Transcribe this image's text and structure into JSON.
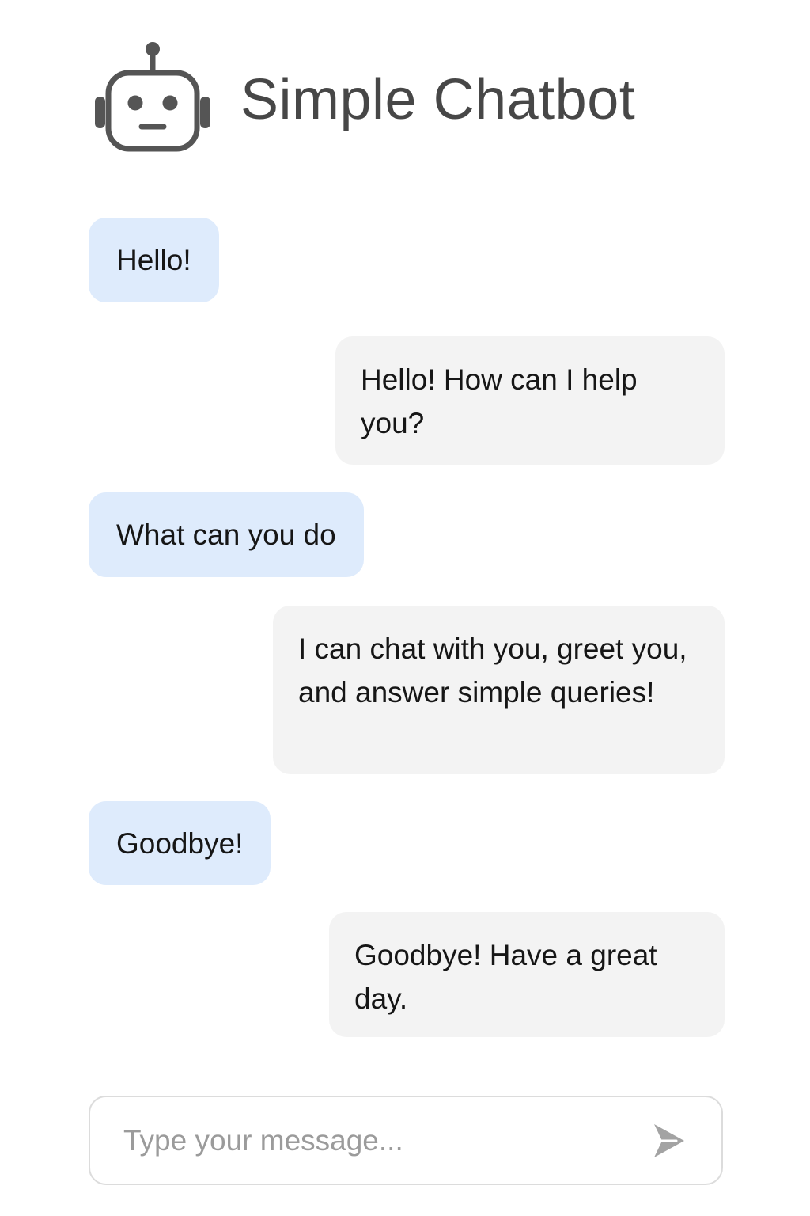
{
  "header": {
    "title": "Simple Chatbot",
    "icon": "robot-icon"
  },
  "messages": [
    {
      "sender": "user",
      "text": "Hello!"
    },
    {
      "sender": "bot",
      "text": "Hello! How can I help you?"
    },
    {
      "sender": "user",
      "text": "What can you do"
    },
    {
      "sender": "bot",
      "text": "I can chat with you, greet you, and answer simple queries!"
    },
    {
      "sender": "user",
      "text": "Goodbye!"
    },
    {
      "sender": "bot",
      "text": "Goodbye! Have a great day."
    }
  ],
  "composer": {
    "placeholder": "Type your message...",
    "value": "",
    "send_icon": "send-icon"
  },
  "colors": {
    "user_bubble": "#deebfc",
    "bot_bubble": "#f3f3f3",
    "title": "#474747",
    "icon": "#555555",
    "send_icon": "#a3a3a3",
    "input_border": "#dcdcdc"
  }
}
